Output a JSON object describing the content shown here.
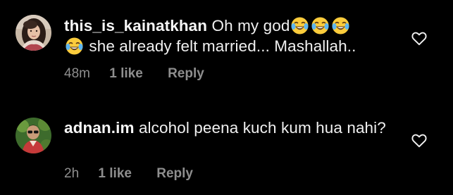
{
  "comments": [
    {
      "username": "this_is_kainatkhan",
      "text_before_emoji": "Oh my god",
      "emoji_name": "face-with-tears-of-joy-icon",
      "emoji_count": 4,
      "text_after_emoji": "she already felt married... Mashallah..",
      "time": "48m",
      "likes": "1 like",
      "reply_label": "Reply",
      "like_icon": "heart-outline-icon"
    },
    {
      "username": "adnan.im",
      "text": "alcohol peena kuch kum hua nahi?",
      "time": "2h",
      "likes": "1 like",
      "reply_label": "Reply",
      "like_icon": "heart-outline-icon"
    }
  ],
  "colors": {
    "background": "#000000",
    "primary_text": "#f5f5f5",
    "secondary_text": "#8e8e8e"
  }
}
